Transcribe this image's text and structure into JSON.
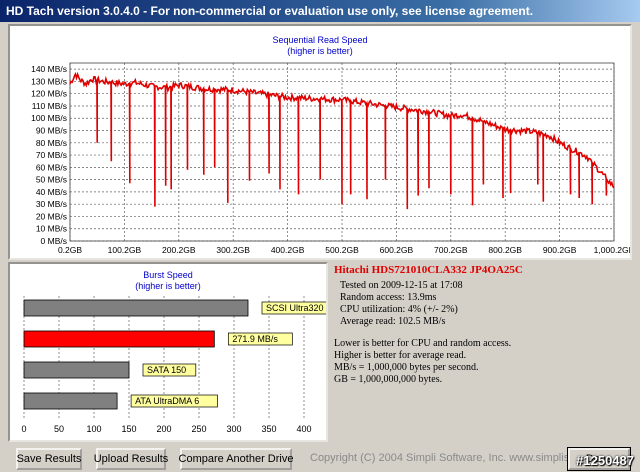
{
  "window": {
    "title": "HD Tach version 3.0.4.0  -  For non-commercial or evaluation use only, see license agreement."
  },
  "read_chart": {
    "title": "Sequential Read Speed",
    "subtitle": "(higher is better)"
  },
  "burst_chart": {
    "title": "Burst Speed",
    "subtitle": "(higher is better)"
  },
  "chart_data": [
    {
      "type": "line",
      "title": "Sequential Read Speed",
      "subtitle": "(higher is better)",
      "y_ticks": [
        "0 MB/s",
        "10 MB/s",
        "20 MB/s",
        "30 MB/s",
        "40 MB/s",
        "50 MB/s",
        "60 MB/s",
        "70 MB/s",
        "80 MB/s",
        "90 MB/s",
        "100 MB/s",
        "110 MB/s",
        "120 MB/s",
        "130 MB/s",
        "140 MB/s"
      ],
      "x_ticks": [
        "0.2GB",
        "100.2GB",
        "200.2GB",
        "300.2GB",
        "400.2GB",
        "500.2GB",
        "600.2GB",
        "700.2GB",
        "800.2GB",
        "900.2GB",
        "1,000.2GB"
      ],
      "xlim": [
        0.2,
        1000.2
      ],
      "ylim": [
        0,
        145
      ],
      "grid": true,
      "color": "#e00000",
      "baseline": {
        "x": [
          0.2,
          10,
          20,
          30,
          40,
          60,
          80,
          100,
          120,
          150,
          180,
          200,
          250,
          300,
          350,
          400,
          450,
          500,
          550,
          600,
          650,
          700,
          720,
          750,
          800,
          850,
          880,
          900,
          950,
          1000.2
        ],
        "y": [
          128,
          136,
          131,
          128,
          132,
          130,
          129,
          128,
          129,
          126,
          125,
          127,
          124,
          123,
          120,
          117,
          116,
          115,
          112,
          109,
          106,
          102,
          103,
          99,
          91,
          89,
          86,
          80,
          69,
          44
        ]
      },
      "dips": {
        "x": [
          50,
          75,
          110,
          155,
          175,
          185,
          215,
          245,
          265,
          290,
          330,
          365,
          385,
          420,
          460,
          500,
          515,
          545,
          580,
          620,
          640,
          660,
          700,
          740,
          760,
          795,
          810,
          860,
          870,
          920,
          935,
          960,
          985
        ],
        "y": [
          80,
          65,
          47,
          28,
          45,
          42,
          58,
          54,
          60,
          31,
          49,
          55,
          42,
          38,
          50,
          30,
          38,
          34,
          50,
          26,
          37,
          43,
          38,
          29,
          46,
          35,
          39,
          46,
          32,
          38,
          35,
          30,
          37
        ]
      }
    },
    {
      "type": "bar",
      "title": "Burst Speed",
      "subtitle": "(higher is better)",
      "categories": [
        "SCSI Ultra320",
        "271.9 MB/s",
        "SATA 150",
        "ATA UltraDMA 6"
      ],
      "values": [
        320,
        271.9,
        150,
        133
      ],
      "colors": [
        "#808080",
        "#ff0000",
        "#808080",
        "#808080"
      ],
      "x_ticks": [
        "0",
        "50",
        "100",
        "150",
        "200",
        "250",
        "300",
        "350",
        "400"
      ],
      "xlim": [
        0,
        400
      ],
      "grid": true
    }
  ],
  "drive": {
    "name": "Hitachi HDS721010CLA332 JP4OA25C",
    "tested_on": "Tested on 2009-12-15 at 17:08",
    "random_access": "Random access: 13.9ms",
    "cpu": "CPU utilization: 4% (+/- 2%)",
    "average_read": "Average read: 102.5 MB/s"
  },
  "notes": [
    "Lower is better for CPU and random access.",
    "Higher is better for average read.",
    "MB/s = 1,000,000 bytes per second.",
    "GB = 1,000,000,000 bytes."
  ],
  "buttons": {
    "save": "Save Results",
    "upload": "Upload Results",
    "compare": "Compare Another Drive",
    "done": "Done"
  },
  "copyright": "Copyright (C) 2004 Simpli Software, Inc. www.simplisoftware.com",
  "watermark": "#1250487"
}
